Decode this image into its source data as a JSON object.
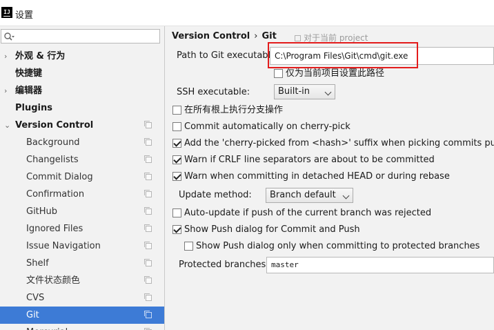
{
  "window": {
    "title": "设置",
    "app_icon_text": "IJ"
  },
  "sidebar": {
    "search_placeholder": "",
    "items": [
      {
        "label": "外观 & 行为",
        "arrow": "›"
      },
      {
        "label": "快捷键"
      },
      {
        "label": "编辑器",
        "arrow": "›"
      },
      {
        "label": "Plugins"
      },
      {
        "label": "Version Control",
        "arrow": "⌄"
      },
      {
        "label": "Background"
      },
      {
        "label": "Changelists"
      },
      {
        "label": "Commit Dialog"
      },
      {
        "label": "Confirmation"
      },
      {
        "label": "GitHub"
      },
      {
        "label": "Ignored Files"
      },
      {
        "label": "Issue Navigation"
      },
      {
        "label": "Shelf"
      },
      {
        "label": "文件状态颜色"
      },
      {
        "label": "CVS"
      },
      {
        "label": "Git"
      },
      {
        "label": "Mercurial"
      }
    ]
  },
  "content": {
    "breadcrumb": {
      "parent": "Version Control",
      "separator": "›",
      "current": "Git"
    },
    "project_note": "对于当前 project",
    "git_path": {
      "label": "Path to Git executable:",
      "value": "C:\\Program Files\\Git\\cmd\\git.exe"
    },
    "path_for_project_only": {
      "label": "仅为当前项目设置此路径",
      "checked": false
    },
    "ssh": {
      "label": "SSH executable:",
      "value": "Built-in"
    },
    "checkboxes": [
      {
        "label": "在所有根上执行分支操作",
        "checked": false
      },
      {
        "label": "Commit automatically on cherry-pick",
        "checked": false
      },
      {
        "label": "Add the 'cherry-picked from <hash>' suffix when picking commits pushed to",
        "checked": true
      },
      {
        "label": "Warn if CRLF line separators are about to be committed",
        "checked": true
      },
      {
        "label": "Warn when committing in detached HEAD or during rebase",
        "checked": true
      }
    ],
    "update_method": {
      "label": "Update method:",
      "value": "Branch default"
    },
    "push_checkboxes": [
      {
        "label": "Auto-update if push of the current branch was rejected",
        "checked": false
      },
      {
        "label": "Show Push dialog for Commit and Push",
        "checked": true
      },
      {
        "label": "Show Push dialog only when committing to protected branches",
        "checked": false
      }
    ],
    "protected_branches": {
      "label": "Protected branches:",
      "value": "master"
    }
  },
  "colors": {
    "selection": "#3d7bd6",
    "highlight_box": "#e31b1b",
    "panel_bg": "#f2f2f2"
  }
}
